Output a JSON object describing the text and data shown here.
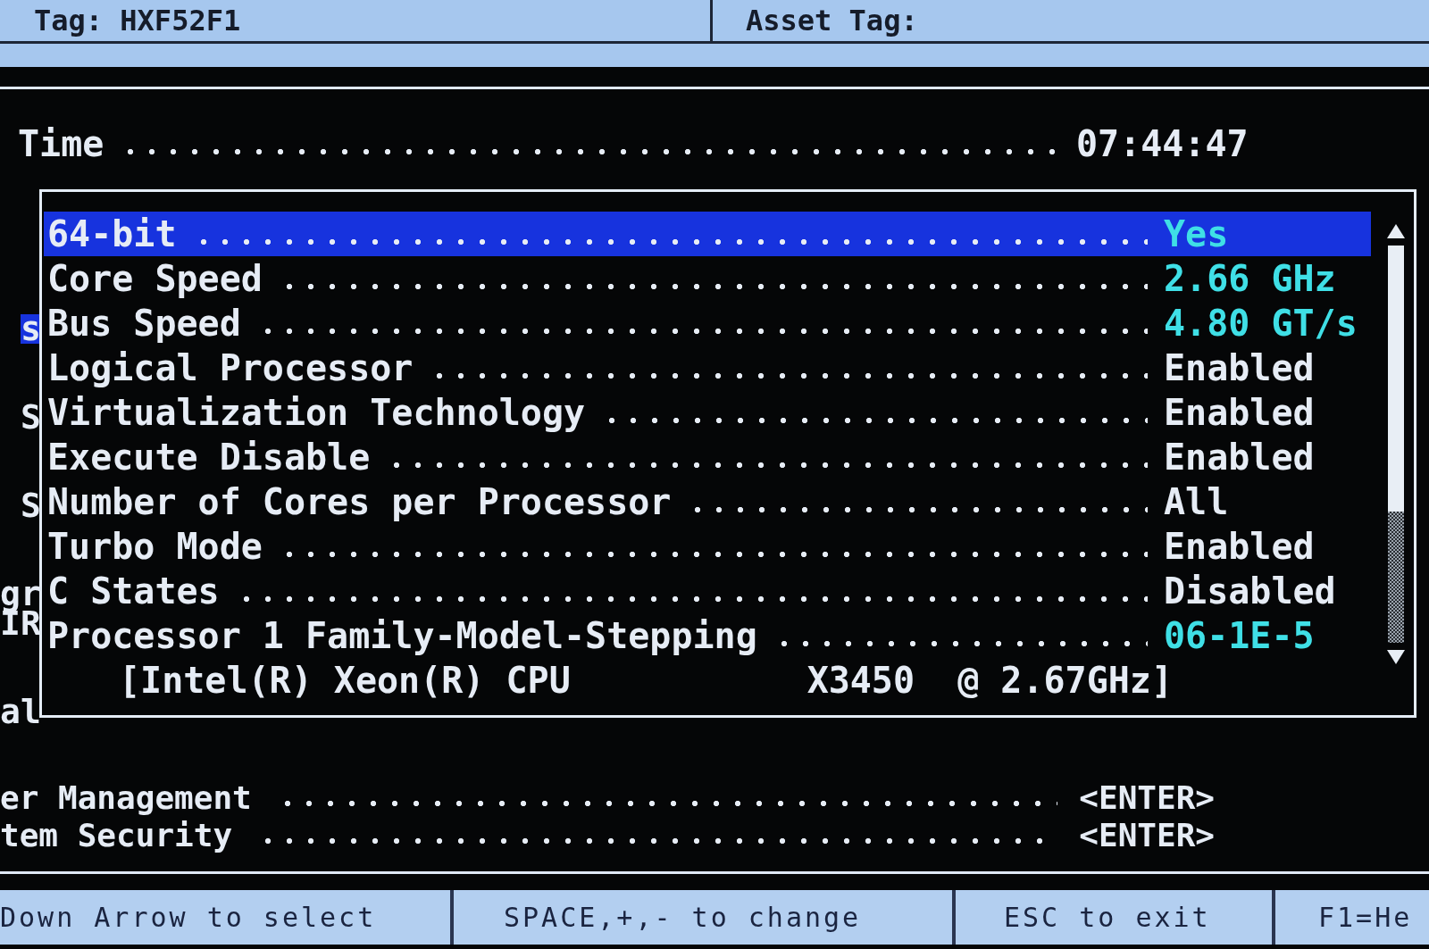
{
  "header": {
    "cells": [
      "Tag: HXF52F1",
      "Asset Tag:"
    ]
  },
  "time": {
    "label": "Time",
    "value": "07:44:47"
  },
  "sidebar": {
    "items": [
      {
        "label": "s",
        "selected": true
      },
      {
        "label": "S",
        "selected": false
      },
      {
        "label": "S",
        "selected": false
      },
      {
        "label": "gr",
        "selected": false
      },
      {
        "label": "IR",
        "selected": false
      },
      {
        "label": "al",
        "selected": false
      }
    ]
  },
  "panel": {
    "rows": [
      {
        "label": "64-bit",
        "value": "Yes",
        "kind": "info",
        "selected": true
      },
      {
        "label": "Core Speed",
        "value": "2.66 GHz",
        "kind": "info",
        "selected": false
      },
      {
        "label": "Bus Speed",
        "value": "4.80 GT/s",
        "kind": "info",
        "selected": false
      },
      {
        "label": "Logical Processor",
        "value": "Enabled",
        "kind": "setting",
        "selected": false
      },
      {
        "label": "Virtualization Technology",
        "value": "Enabled",
        "kind": "setting",
        "selected": false
      },
      {
        "label": "Execute Disable",
        "value": "Enabled",
        "kind": "setting",
        "selected": false
      },
      {
        "label": "Number of Cores per Processor",
        "value": "All",
        "kind": "setting",
        "selected": false
      },
      {
        "label": "Turbo Mode",
        "value": "Enabled",
        "kind": "setting",
        "selected": false
      },
      {
        "label": "C States",
        "value": "Disabled",
        "kind": "setting",
        "selected": false
      },
      {
        "label": "Processor 1 Family-Model-Stepping",
        "value": "06-1E-5",
        "kind": "info",
        "selected": false,
        "detail": "[Intel(R) Xeon(R) CPU           X3450  @ 2.67GHz]"
      }
    ]
  },
  "menu": {
    "items": [
      {
        "label": "er Management",
        "value": "<ENTER>"
      },
      {
        "label": "tem Security",
        "value": "<ENTER>"
      }
    ]
  },
  "status_bar": {
    "hints": [
      "Down Arrow to select",
      "SPACE,+,- to change",
      "ESC to exit",
      "F1=He"
    ]
  }
}
